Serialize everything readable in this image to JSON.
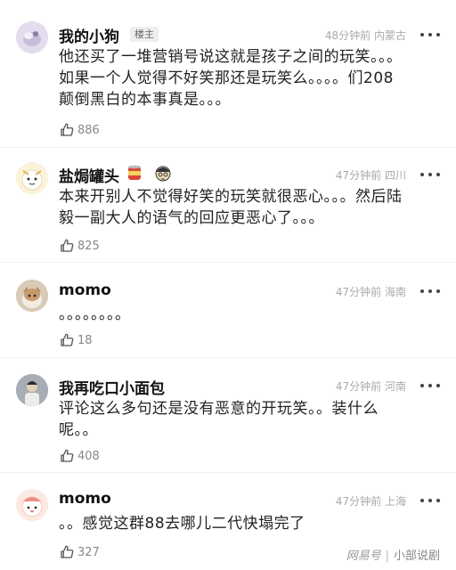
{
  "comments": [
    {
      "username": "我的小狗",
      "badge": "楼主",
      "time": "48分钟前",
      "location": "内蒙古",
      "lines": [
        "他还买了一堆营销号说这就是孩子之间的玩笑。。。",
        "如果一个人觉得不好笑那还是玩笑么。。。。们208",
        "颠倒黑白的本事真是。。。"
      ],
      "likes": "886"
    },
    {
      "username": "盐焗罐头",
      "time": "47分钟前",
      "location": "四川",
      "lines": [
        "本来开别人不觉得好笑的玩笑就很恶心。。。然后陆",
        "毅一副大人的语气的回应更恶心了。。。"
      ],
      "likes": "825"
    },
    {
      "username": "momo",
      "time": "47分钟前",
      "location": "海南",
      "lines": [
        "。。。。。。。。"
      ],
      "likes": "18"
    },
    {
      "username": "我再吃口小面包",
      "time": "47分钟前",
      "location": "河南",
      "lines": [
        "评论这么多句还是没有恶意的开玩笑。。装什么",
        "呢。。"
      ],
      "likes": "408"
    },
    {
      "username": "momo",
      "time": "47分钟前",
      "location": "上海",
      "lines": [
        "。。感觉这群88去哪儿二代快塌完了"
      ],
      "likes": "327"
    }
  ],
  "footer": {
    "brand": "网易号",
    "account": "小部说剧"
  },
  "colors": {
    "text": "#222222",
    "meta": "#aaaaaa",
    "badge_bg": "#eeeeee"
  }
}
